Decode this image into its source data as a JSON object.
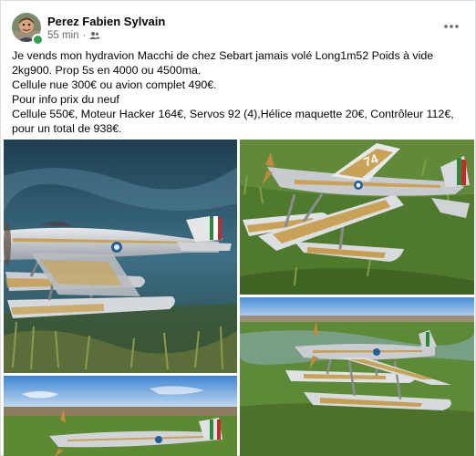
{
  "post": {
    "author": "Perez Fabien Sylvain",
    "time": "55 min",
    "separator": "·",
    "audience_icon": "friends-icon",
    "more_icon": "more-options-icon",
    "text_lines": [
      "Je vends mon hydravion Macchi de chez Sebart jamais volé Long1m52 Poids à vide 2kg900. Prop 5s en 4000 ou 4500ma.",
      "Cellule nue 300€ ou avion complet 490€.",
      "Pour info prix du neuf",
      "Cellule 550€, Moteur Hacker 164€, Servos 92 (4),Hélice maquette 20€, Contrôleur 112€, pour un total de 938€."
    ]
  },
  "photos": {
    "tail_number": "74"
  },
  "colors": {
    "online": "#31a24c",
    "text": "#050505",
    "meta": "#65676b"
  }
}
